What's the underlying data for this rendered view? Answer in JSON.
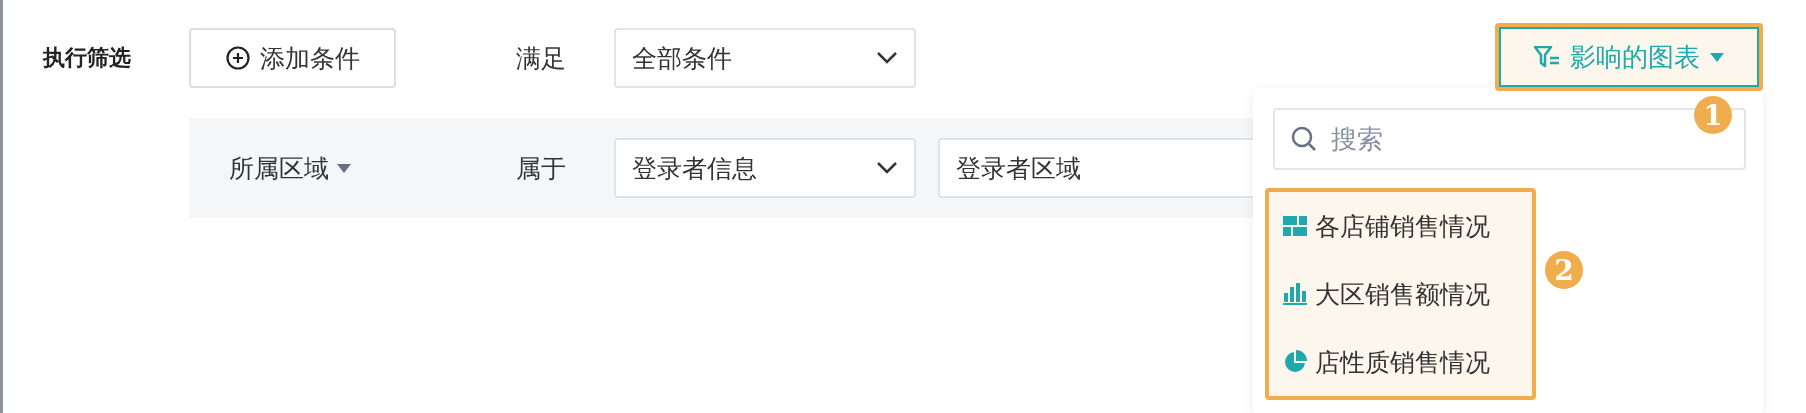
{
  "filter": {
    "label": "执行筛选",
    "add_button": "添加条件",
    "match_label": "满足",
    "match_select": "全部条件",
    "condition": {
      "field": "所属区域",
      "operator": "属于",
      "source_select": "登录者信息",
      "value_select": "登录者区域"
    }
  },
  "affected_charts": {
    "label": "影响的图表",
    "expanded": true,
    "badge": "1",
    "search": {
      "placeholder": "搜索"
    },
    "items_badge": "2",
    "items": [
      {
        "kind": "grid",
        "label": "各店铺销售情况"
      },
      {
        "kind": "bar",
        "label": "大区销售额情况"
      },
      {
        "kind": "pie",
        "label": "店性质销售情况"
      }
    ]
  }
}
